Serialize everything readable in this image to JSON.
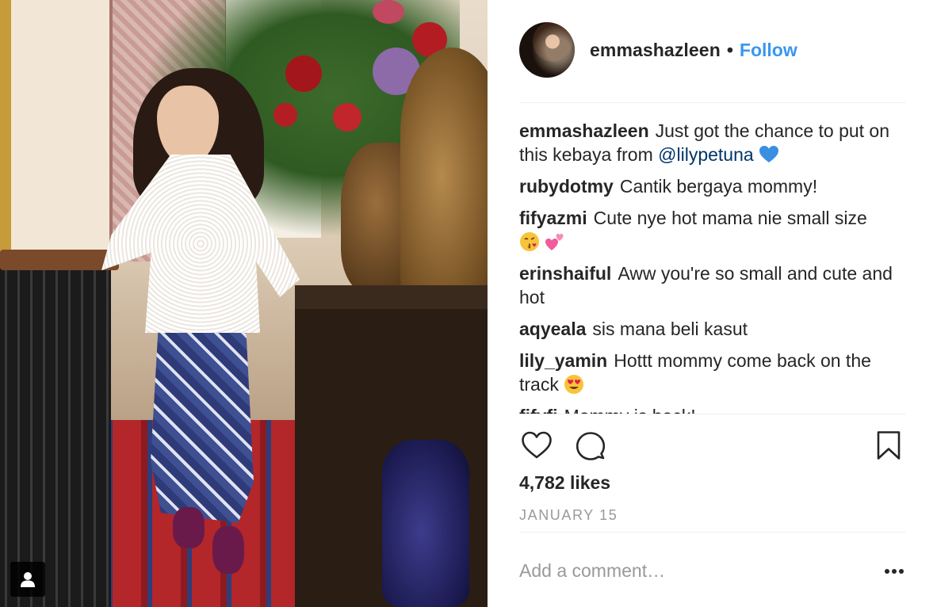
{
  "post": {
    "owner": {
      "username": "emmashazleen",
      "separator": "•",
      "follow_label": "Follow"
    },
    "comments": [
      {
        "user": "emmashazleen",
        "text": "Just got the chance to put on this kebaya from ",
        "mention": "@lilypetuna",
        "emoji": "blue-heart"
      },
      {
        "user": "rubydotmy",
        "text": "Cantik bergaya mommy!"
      },
      {
        "user": "fifyazmi",
        "text": "Cute nye hot mama nie small size",
        "emoji": "kiss-and-hearts"
      },
      {
        "user": "erinshaiful",
        "text": "Aww you're so small and cute and hot"
      },
      {
        "user": "aqyeala",
        "text": "sis mana beli kasut"
      },
      {
        "user": "lily_yamin",
        "text": "Hottt mommy come back on the track",
        "emoji": "heart-eyes"
      },
      {
        "user": "fifyfi",
        "text": "Mommy is back!"
      }
    ],
    "likes": "4,782 likes",
    "date": "JANUARY 15",
    "add_comment_placeholder": "Add a comment…"
  },
  "colors": {
    "link": "#3897f0",
    "mention": "#003569",
    "muted": "#999999",
    "divider": "#efefef"
  },
  "icons": [
    "user-tag-icon",
    "heart-icon",
    "comment-icon",
    "bookmark-icon",
    "more-icon"
  ]
}
